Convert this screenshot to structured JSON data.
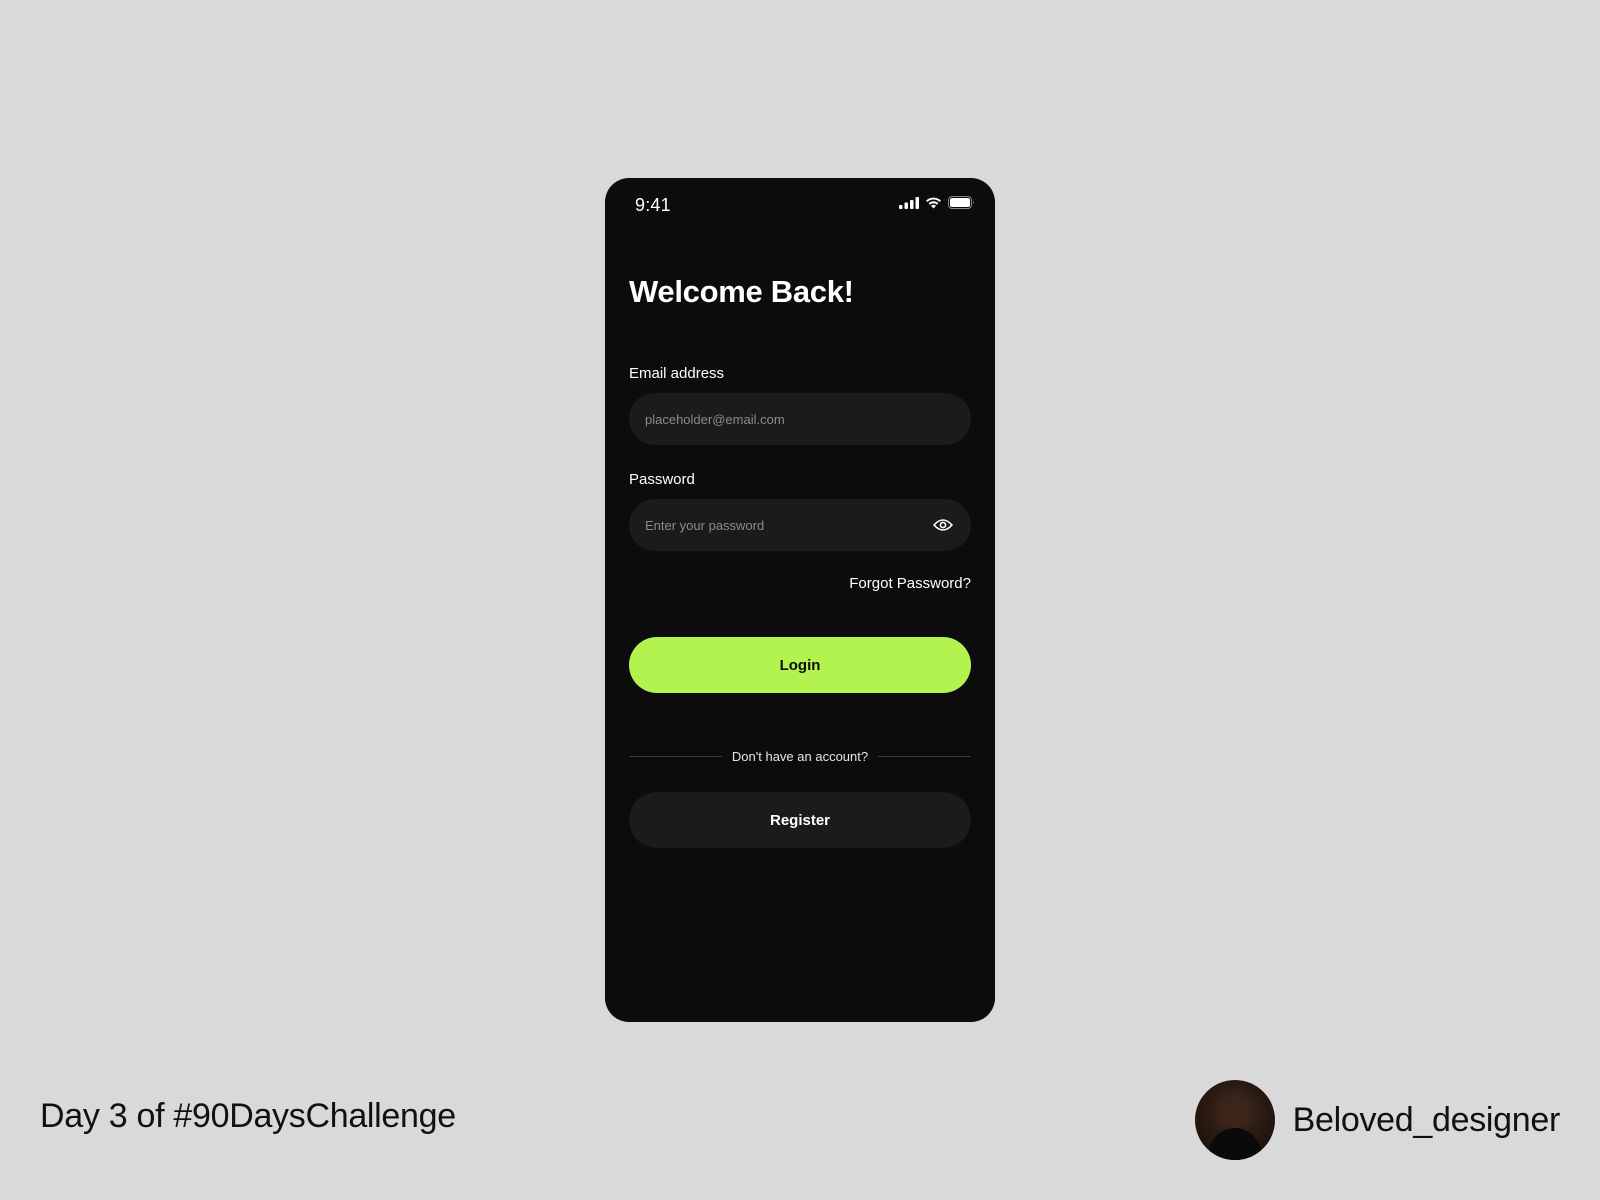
{
  "status_bar": {
    "time": "9:41",
    "icons": [
      "cellular-signal-icon",
      "wifi-icon",
      "battery-icon"
    ]
  },
  "login": {
    "title": "Welcome Back!",
    "email_label": "Email address",
    "email_placeholder": "placeholder@email.com",
    "email_value": "",
    "password_label": "Password",
    "password_placeholder": "Enter your password",
    "password_value": "",
    "forgot_label": "Forgot Password?",
    "login_label": "Login",
    "divider_text": "Don't have an account?",
    "register_label": "Register"
  },
  "footer": {
    "caption": "Day 3 of #90DaysChallenge",
    "handle": "Beloved_designer"
  },
  "colors": {
    "background": "#d9d9d9",
    "screen": "#0c0c0c",
    "input": "#1b1b1b",
    "accent": "#b2f34f",
    "text_light": "#ffffff",
    "text_dark": "#111111"
  }
}
